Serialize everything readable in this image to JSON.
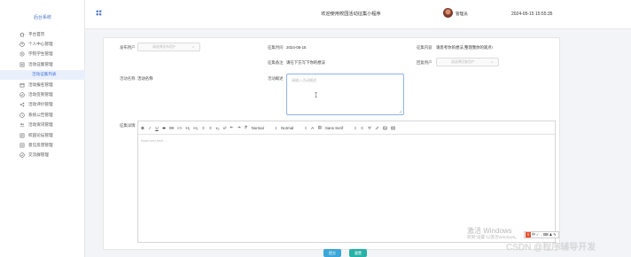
{
  "sidebar": {
    "brand": "后台系统",
    "items": [
      {
        "label": "平台首页",
        "icon": "home-icon"
      },
      {
        "label": "个人中心管理",
        "icon": "user-circle-icon"
      },
      {
        "label": "学院学生管理",
        "icon": "settings-icon"
      },
      {
        "label": "活动征集管理",
        "icon": "document-icon"
      },
      {
        "label": "活动征集列表",
        "icon": "",
        "active": true
      },
      {
        "label": "活动报名管理",
        "icon": "calendar-icon"
      },
      {
        "label": "活动签到管理",
        "icon": "checkin-icon"
      },
      {
        "label": "活动评价管理",
        "icon": "share-icon"
      },
      {
        "label": "系统公告管理",
        "icon": "notice-icon"
      },
      {
        "label": "活动资讯管理",
        "icon": "people-icon"
      },
      {
        "label": "校园论坛管理",
        "icon": "forum-icon"
      },
      {
        "label": "意见反馈管理",
        "icon": "feedback-icon"
      },
      {
        "label": "交流群管理",
        "icon": "chat-icon"
      }
    ]
  },
  "header": {
    "title": "欢迎使用校园活动征集小程序",
    "username": "管理员",
    "datetime": "2024-05-15 15:55:35"
  },
  "form": {
    "publisher_label": "发布用户",
    "publisher_placeholder": "请选择发布用户",
    "publish_time_label": "征集时间",
    "publish_time_value": "2024-05-15",
    "reply_label": "征集内容",
    "reply_value": "请思考你的想法,整理我你的观点!",
    "collect_desc_label": "征集备注",
    "collect_desc_value": "请在下方写下你的想法",
    "reply_user_label": "回复用户",
    "reply_user_placeholder": "请选择回复用户",
    "name_label": "活动名称",
    "name_value": "活动名称",
    "summary_label": "活动概述",
    "summary_placeholder": "请输入活动概述",
    "details_label": "征集详情"
  },
  "editor": {
    "tools": [
      "B",
      "I",
      "U",
      "S",
      "99",
      "<>",
      "H₁",
      "H₂",
      "≡",
      "≡",
      "x₂",
      "x²",
      "⇤",
      "⇥",
      "⁋"
    ],
    "size_select": "Normal",
    "header_select": "Normal",
    "font_select": "Sans Serif",
    "placeholder": "Insert text here ..."
  },
  "buttons": {
    "submit": "提交",
    "reset": "重置"
  },
  "overlay": {
    "ime": [
      "S",
      "中",
      "✓",
      "·,",
      "⌨",
      "♟",
      "✎"
    ],
    "windows_activate": "激活 Windows",
    "windows_hint": "转到\"设置\"以激活Windows。",
    "csdn_watermark": "CSDN @程序辅导开发"
  },
  "colors": {
    "accent": "#3b6fd8",
    "submit_button": "#3ba6d8",
    "reset_button": "#27b2a6"
  }
}
